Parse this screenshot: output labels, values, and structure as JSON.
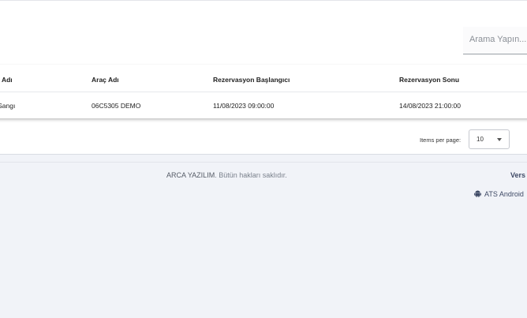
{
  "search": {
    "placeholder": "Arama Yapın..."
  },
  "table": {
    "columns": [
      "cü Adı",
      "Araç Adı",
      "Rezervasyon Başlangıcı",
      "Rezervasyon Sonu"
    ],
    "rows": [
      [
        "a Sangı",
        "06C5305 DEMO",
        "11/08/2023 09:00:00",
        "14/08/2023 21:00:00"
      ]
    ]
  },
  "pagination": {
    "items_per_page_label": "Items per page:",
    "selected": "10"
  },
  "footer": {
    "brand": "ARCA YAZILIM",
    "rights": ". Bütün hakları saklıdır.",
    "version_label": "Vers",
    "android_label": "ATS Android",
    "android_icon": "android-icon"
  }
}
